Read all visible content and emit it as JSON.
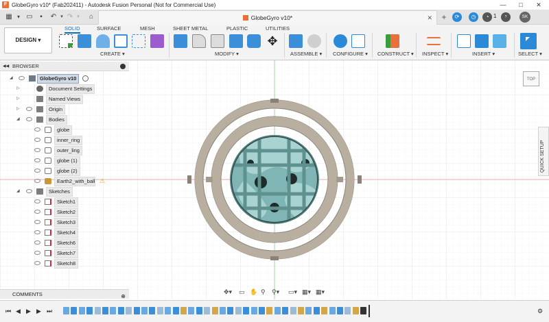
{
  "window": {
    "title": "GlobeGyro v10* (Fab202411) - Autodesk Fusion Personal (Not for Commercial Use)",
    "app_icon_letter": "F",
    "minimize": "—",
    "maximize": "□",
    "close": "✕"
  },
  "tabbar": {
    "doc_tab": "GlobeGyro v10*",
    "doc_close": "✕",
    "plus": "+",
    "notif_count": "1",
    "user_initials": "SK",
    "help": "?"
  },
  "ribbon": {
    "workspace": "DESIGN ▾",
    "tabs": [
      "SOLID",
      "SURFACE",
      "MESH",
      "SHEET METAL",
      "PLASTIC",
      "UTILITIES"
    ],
    "groups": [
      "CREATE ▾",
      "MODIFY ▾",
      "ASSEMBLE ▾",
      "CONFIGURE ▾",
      "CONSTRUCT ▾",
      "INSPECT ▾",
      "INSERT ▾",
      "SELECT ▾"
    ]
  },
  "browser": {
    "header": "BROWSER",
    "root": "GlobeGyro v10",
    "items": [
      {
        "label": "Document Settings",
        "depth": 1,
        "icon": "gear-icon"
      },
      {
        "label": "Named Views",
        "depth": 1,
        "icon": "folder-icon"
      },
      {
        "label": "Origin",
        "depth": 1,
        "icon": "folder-icon"
      },
      {
        "label": "Bodies",
        "depth": 1,
        "icon": "folder-icon"
      },
      {
        "label": "globe",
        "depth": 2,
        "icon": "body-icon"
      },
      {
        "label": "inner_ring",
        "depth": 2,
        "icon": "body-icon"
      },
      {
        "label": "outer_ling",
        "depth": 2,
        "icon": "body-icon"
      },
      {
        "label": "globe (1)",
        "depth": 2,
        "icon": "body-icon"
      },
      {
        "label": "globe (2)",
        "depth": 2,
        "icon": "body-icon"
      },
      {
        "label": "Earth2_with_ball_f",
        "depth": 2,
        "icon": "mesh-body-icon"
      },
      {
        "label": "Sketches",
        "depth": 1,
        "icon": "folder-icon"
      },
      {
        "label": "Sketch1",
        "depth": 2,
        "icon": "sketch-icon"
      },
      {
        "label": "Sketch2",
        "depth": 2,
        "icon": "sketch-icon"
      },
      {
        "label": "Sketch3",
        "depth": 2,
        "icon": "sketch-icon"
      },
      {
        "label": "Sketch4",
        "depth": 2,
        "icon": "sketch-icon"
      },
      {
        "label": "Sketch6",
        "depth": 2,
        "icon": "sketch-icon"
      },
      {
        "label": "Sketch7",
        "depth": 2,
        "icon": "sketch-icon"
      },
      {
        "label": "Sketch8",
        "depth": 2,
        "icon": "sketch-icon"
      }
    ],
    "warning": "⚠"
  },
  "comments": {
    "label": "COMMENTS"
  },
  "viewport": {
    "viewcube_face": "TOP",
    "quick_setup": "QUICK SETUP"
  },
  "colors": {
    "accent": "#0a6fc2",
    "ring": "#b4aa9a",
    "globe": "#8dbfbf",
    "cage": "#6fa2a1",
    "brand": "#e8703a"
  },
  "icons": {
    "warning": "warning-icon",
    "eye": "eye-icon",
    "play": "play-icon"
  }
}
